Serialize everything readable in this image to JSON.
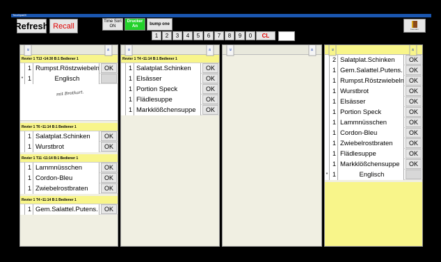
{
  "window": {
    "title": "TouchpadX"
  },
  "toolbar": {
    "refresh_label": "Refresh",
    "recall_label": "Recall",
    "timesort_line1": "Time Sort",
    "timesort_line2": "ON",
    "drucker_line1": "Drucker",
    "drucker_line2": "An",
    "bump_label": "bump one",
    "exit_label": "beenden",
    "numpad": [
      "1",
      "2",
      "3",
      "4",
      "5",
      "6",
      "7",
      "8",
      "9",
      "0"
    ],
    "clear_label": "CL",
    "input_value": ""
  },
  "columns": [
    {
      "orders": [
        {
          "header": "Revier 1 T13 •14:30 B:1 Bediener 1",
          "items": [
            {
              "mark": "",
              "qty": "1",
              "name": "Rumpst.Röstzwiebeln",
              "ok": "OK"
            },
            {
              "mark": "*",
              "qty": "1",
              "name": "Englisch",
              "ok": ""
            }
          ],
          "note": "mit Brotkart."
        },
        {
          "header": "Revier 1 T6 •11:14 B:1 Bediener 1",
          "items": [
            {
              "mark": "",
              "qty": "1",
              "name": "Salatplat.Schinken",
              "ok": "OK"
            },
            {
              "mark": "",
              "qty": "1",
              "name": "Wurstbrot",
              "ok": "OK"
            }
          ]
        },
        {
          "header": "Revier 1 T11 •11:14 B:1 Bediener 1",
          "items": [
            {
              "mark": "",
              "qty": "1",
              "name": "Lammnüsschen",
              "ok": "OK"
            },
            {
              "mark": "",
              "qty": "1",
              "name": "Cordon-Bleu",
              "ok": "OK"
            },
            {
              "mark": "",
              "qty": "1",
              "name": "Zwiebelrostbraten",
              "ok": "OK"
            }
          ]
        },
        {
          "header": "Revier 1 T4 •11:14 B:1 Bediener 1",
          "items": [
            {
              "mark": "",
              "qty": "1",
              "name": "Gem.Salattel.Putens.",
              "ok": "OK"
            }
          ]
        }
      ]
    },
    {
      "orders": [
        {
          "header": "Revier 1 T4 •11:14 B:1 Bediener 1",
          "items": [
            {
              "mark": "",
              "qty": "1",
              "name": "Salatplat.Schinken",
              "ok": "OK"
            },
            {
              "mark": "",
              "qty": "1",
              "name": "Elsässer",
              "ok": "OK"
            },
            {
              "mark": "",
              "qty": "1",
              "name": "Portion Speck",
              "ok": "OK"
            },
            {
              "mark": "",
              "qty": "1",
              "name": "Flädlesuppe",
              "ok": "OK"
            },
            {
              "mark": "",
              "qty": "1",
              "name": "Markklößchensuppe",
              "ok": "OK"
            }
          ]
        }
      ]
    },
    {
      "orders": []
    },
    {
      "orders": [
        {
          "header": "",
          "items": [
            {
              "mark": "",
              "qty": "2",
              "name": "Salatplat.Schinken",
              "ok": "OK"
            },
            {
              "mark": "",
              "qty": "1",
              "name": "Gem.Salattel.Putens.",
              "ok": "OK"
            },
            {
              "mark": "",
              "qty": "1",
              "name": "Rumpst.Röstzwiebeln",
              "ok": "OK"
            },
            {
              "mark": "",
              "qty": "1",
              "name": "Wurstbrot",
              "ok": "OK"
            },
            {
              "mark": "",
              "qty": "1",
              "name": "Elsässer",
              "ok": "OK"
            },
            {
              "mark": "",
              "qty": "1",
              "name": "Portion Speck",
              "ok": "OK"
            },
            {
              "mark": "",
              "qty": "1",
              "name": "Lammnüsschen",
              "ok": "OK"
            },
            {
              "mark": "",
              "qty": "1",
              "name": "Cordon-Bleu",
              "ok": "OK"
            },
            {
              "mark": "",
              "qty": "1",
              "name": "Zwiebelrostbraten",
              "ok": "OK"
            },
            {
              "mark": "",
              "qty": "1",
              "name": "Flädlesuppe",
              "ok": "OK"
            },
            {
              "mark": "",
              "qty": "1",
              "name": "Markklößchensuppe",
              "ok": "OK"
            },
            {
              "mark": "*",
              "qty": "1",
              "name": "Englisch",
              "ok": ""
            }
          ]
        }
      ]
    }
  ],
  "colors": {
    "header_yellow": "#f8f58a",
    "drucker_green": "#22d22a",
    "recall_red": "#e00000",
    "titlebar_blue": "#1a56b0"
  }
}
